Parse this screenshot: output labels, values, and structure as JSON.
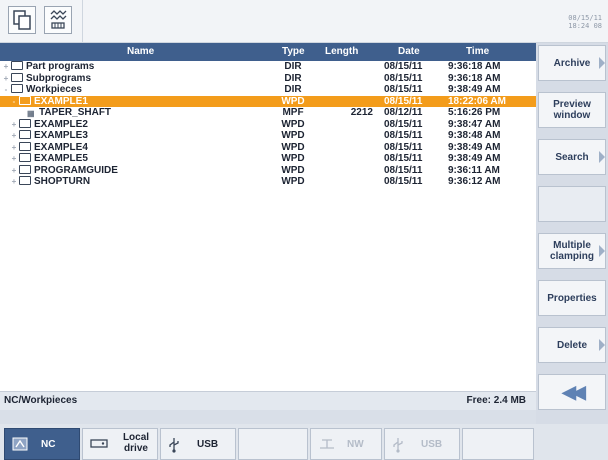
{
  "header": {
    "icons": [
      "copy-icon",
      "machine-icon"
    ],
    "date_line1": "08/15/11",
    "date_line2": "18:24 08"
  },
  "columns": {
    "name": "Name",
    "type": "Type",
    "length": "Length",
    "date": "Date",
    "time": "Time"
  },
  "rows": [
    {
      "indent": 0,
      "expander": "+",
      "icon": "folder",
      "name": "Part programs",
      "type": "DIR",
      "length": "",
      "date": "08/15/11",
      "time": "9:36:18 AM",
      "selected": false
    },
    {
      "indent": 0,
      "expander": "+",
      "icon": "folder",
      "name": "Subprograms",
      "type": "DIR",
      "length": "",
      "date": "08/15/11",
      "time": "9:36:18 AM",
      "selected": false
    },
    {
      "indent": 0,
      "expander": "-",
      "icon": "folder",
      "name": "Workpieces",
      "type": "DIR",
      "length": "",
      "date": "08/15/11",
      "time": "9:38:49 AM",
      "selected": false
    },
    {
      "indent": 1,
      "expander": "-",
      "icon": "folder",
      "name": "EXAMPLE1",
      "type": "WPD",
      "length": "",
      "date": "08/15/11",
      "time": "18:22:06 AM",
      "selected": true
    },
    {
      "indent": 2,
      "expander": "",
      "icon": "file",
      "name": "TAPER_SHAFT",
      "type": "MPF",
      "length": "2212",
      "date": "08/12/11",
      "time": "5:16:26 PM",
      "selected": false
    },
    {
      "indent": 1,
      "expander": "+",
      "icon": "folder",
      "name": "EXAMPLE2",
      "type": "WPD",
      "length": "",
      "date": "08/15/11",
      "time": "9:38:47 AM",
      "selected": false
    },
    {
      "indent": 1,
      "expander": "+",
      "icon": "folder",
      "name": "EXAMPLE3",
      "type": "WPD",
      "length": "",
      "date": "08/15/11",
      "time": "9:38:48 AM",
      "selected": false
    },
    {
      "indent": 1,
      "expander": "+",
      "icon": "folder",
      "name": "EXAMPLE4",
      "type": "WPD",
      "length": "",
      "date": "08/15/11",
      "time": "9:38:49 AM",
      "selected": false
    },
    {
      "indent": 1,
      "expander": "+",
      "icon": "folder",
      "name": "EXAMPLE5",
      "type": "WPD",
      "length": "",
      "date": "08/15/11",
      "time": "9:38:49 AM",
      "selected": false
    },
    {
      "indent": 1,
      "expander": "+",
      "icon": "folder",
      "name": "PROGRAMGUIDE",
      "type": "WPD",
      "length": "",
      "date": "08/15/11",
      "time": "9:36:11 AM",
      "selected": false
    },
    {
      "indent": 1,
      "expander": "+",
      "icon": "folder",
      "name": "SHOPTURN",
      "type": "WPD",
      "length": "",
      "date": "08/15/11",
      "time": "9:36:12 AM",
      "selected": false
    }
  ],
  "status": {
    "path": "NC/Workpieces",
    "free": "Free: 2.4 MB"
  },
  "side_keys": [
    {
      "label": "Archive",
      "arrow": true
    },
    {
      "label": "Preview window",
      "arrow": false
    },
    {
      "label": "Search",
      "arrow": true
    },
    {
      "label": "",
      "arrow": false
    },
    {
      "label": "Multiple clamping",
      "arrow": true
    },
    {
      "label": "Properties",
      "arrow": false
    },
    {
      "label": "Delete",
      "arrow": true
    },
    {
      "label": "◀◀",
      "arrow": false
    }
  ],
  "bottom_keys": [
    {
      "label": "NC",
      "icon": "nc-icon",
      "active": true
    },
    {
      "label": "Local drive",
      "icon": "drive-icon",
      "active": false
    },
    {
      "label": "USB",
      "icon": "usb-icon",
      "active": false
    },
    {
      "label": "",
      "icon": "",
      "active": false
    },
    {
      "label": "NW",
      "icon": "network-icon",
      "active": false,
      "dim": true
    },
    {
      "label": "USB",
      "icon": "usb-icon",
      "active": false,
      "dim": true
    },
    {
      "label": "",
      "icon": "",
      "active": false
    }
  ],
  "colors": {
    "header_blue": "#3f5f8d",
    "selection_orange": "#f39c1b",
    "softkey_text": "#2d3e5c"
  }
}
